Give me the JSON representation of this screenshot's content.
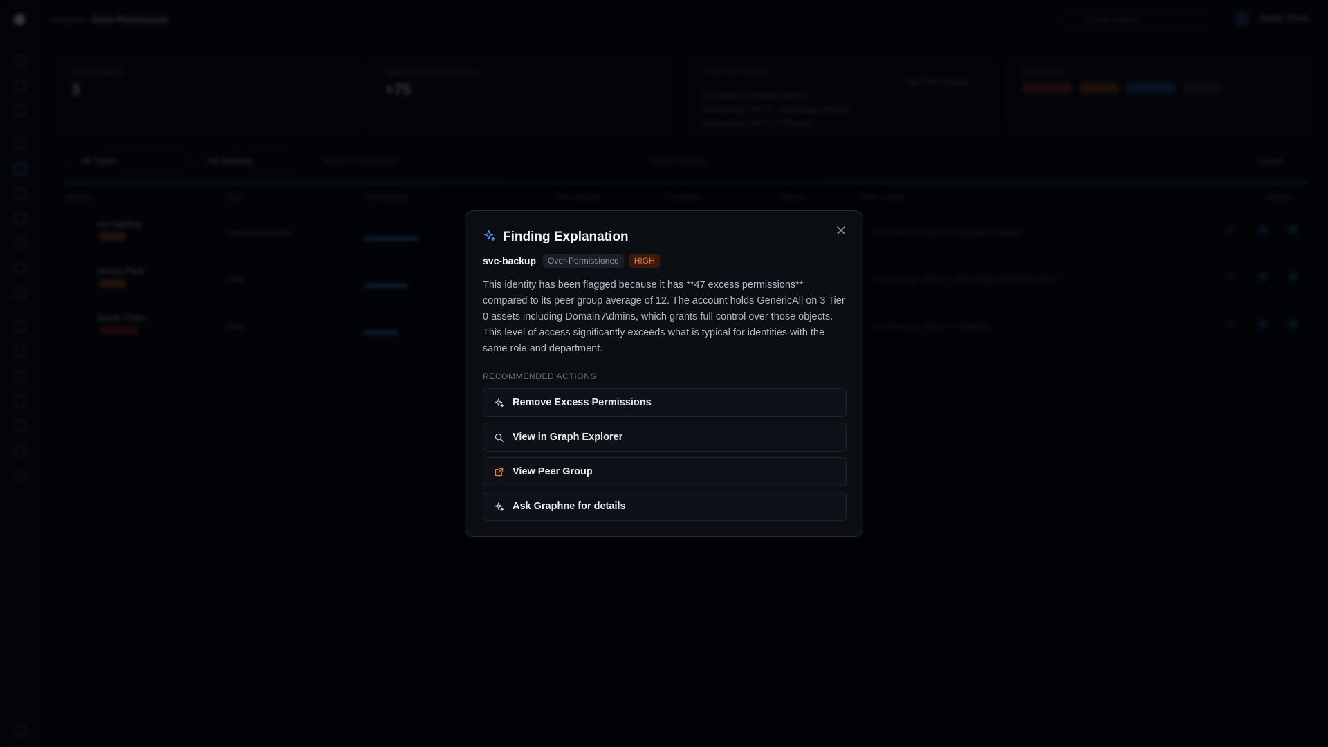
{
  "background": {
    "breadcrumb": {
      "parent": "Analysis",
      "current": "Over-Permission"
    },
    "search_placeholder": "Quick Search",
    "user_name": "Sarah Chen",
    "cards": [
      {
        "title": "Total Findings",
        "value": "3"
      },
      {
        "title": "Total Excess Permissions",
        "value": "+75"
      },
      {
        "title": "Top Tier 0 Assets",
        "extra": "Top Peer Groups",
        "lines": [
          "svc-backup: Domain Admins",
          "svc-backup: Tier 0 — Exchange Admins",
          "svc-backup: Tier 0 — Finance"
        ]
      },
      {
        "title": "By Severity"
      }
    ],
    "filters": {
      "type": "All Types",
      "severity": "All Severity",
      "sort_label": "Excess Permissions",
      "threshold_label": "Above Average",
      "export": "Export"
    },
    "columns": [
      "Identity",
      "Type",
      "Permissions",
      "Peer Weight",
      "Deviation",
      "Groups",
      "Peer Group",
      "Actions"
    ],
    "rows": [
      {
        "name": "svc-backup",
        "type": "Service Account",
        "path": "svc-backup: Tier 0 — Domain Admins"
      },
      {
        "name": "James Park",
        "type": "User",
        "path": "svc-backup: Tier 0 — Exchange Administrators"
      },
      {
        "name": "Sarah Chen",
        "type": "User",
        "path": "svc-backup: Tier 0 — Finance"
      }
    ]
  },
  "modal": {
    "title": "Finding Explanation",
    "identity": "svc-backup",
    "finding_type": "Over-Permissioned",
    "severity": "HIGH",
    "description": "This identity has been flagged because it has **47 excess permissions** compared to its peer group average of 12. The account holds GenericAll on 3 Tier 0 assets including Domain Admins, which grants full control over those objects. This level of access significantly exceeds what is typical for identities with the same role and department.",
    "section_label": "RECOMMENDED ACTIONS",
    "actions": [
      {
        "label": "Remove Excess Permissions",
        "icon": "sparkles-icon"
      },
      {
        "label": "View in Graph Explorer",
        "icon": "search-icon"
      },
      {
        "label": "View Peer Group",
        "icon": "external-link-icon"
      },
      {
        "label": "Ask Graphne for details",
        "icon": "sparkles-icon"
      }
    ]
  },
  "colors": {
    "accent": "#4f8ef7",
    "severity_high": "#f07c2f",
    "severity_high_bg": "#3a1a0c",
    "peer_group_icon": "#f07c2f"
  }
}
